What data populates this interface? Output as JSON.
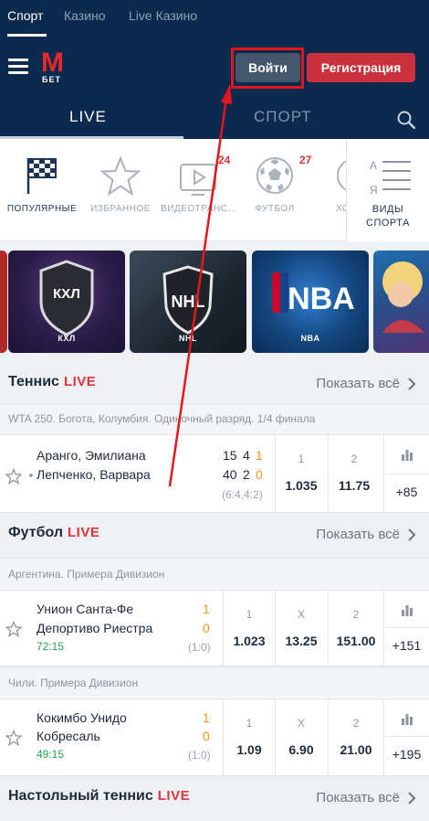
{
  "top_tabs": [
    "Спорт",
    "Казино",
    "Live Казино"
  ],
  "logo": {
    "letter": "M",
    "sub": "БЕТ"
  },
  "header": {
    "login": "Войти",
    "register": "Регистрация"
  },
  "sub_tabs": {
    "live": "LIVE",
    "sport": "СПОРТ"
  },
  "categories": [
    {
      "label": "ПОПУЛЯРНЫЕ",
      "icon": "flag-icon",
      "badge": ""
    },
    {
      "label": "ИЗБРАННОЕ",
      "icon": "star-icon",
      "badge": ""
    },
    {
      "label": "ВИДЕОТРАНС…",
      "icon": "video-icon",
      "badge": "24"
    },
    {
      "label": "ФУТБОЛ",
      "icon": "soccer-ball-icon",
      "badge": "27"
    },
    {
      "label": "ХО",
      "icon": "hockey-icon",
      "badge": ""
    }
  ],
  "sports_kinds": {
    "line1": "ВИДЫ",
    "line2": "СПОРТА",
    "az_top": "А",
    "az_bottom": "Я"
  },
  "banners": [
    "КХЛ",
    "NHL",
    "NBA"
  ],
  "banner_logos": {
    "khl": "КХЛ",
    "nhl": "NHL",
    "nba": "NBA"
  },
  "sections": [
    {
      "title": "Теннис",
      "live": "LIVE",
      "show_all": "Показать всё",
      "league": "WTA 250. Богота, Колумбия. Одиночный разряд. 1/4 финала",
      "event": {
        "team1": "Аранго, Эмилиана",
        "team2": "Лепченко, Варвара",
        "score1": [
          "15",
          "4",
          "1"
        ],
        "score2": [
          "40",
          "2",
          "0"
        ],
        "sets": "(6:4,4:2)",
        "odds": [
          {
            "l": "1",
            "v": "1.035"
          },
          {
            "l": "2",
            "v": "11.75"
          }
        ],
        "more": "+85"
      }
    },
    {
      "title": "Футбол",
      "live": "LIVE",
      "show_all": "Показать всё",
      "leagues": [
        {
          "name": "Аргентина. Примера Дивизион",
          "team1": "Унион Санта-Фе",
          "team2": "Депортиво Риестра",
          "score1": "1",
          "score2": "0",
          "time": "72:15",
          "half": "(1:0)",
          "odds": [
            {
              "l": "1",
              "v": "1.023"
            },
            {
              "l": "X",
              "v": "13.25"
            },
            {
              "l": "2",
              "v": "151.00"
            }
          ],
          "more": "+151"
        },
        {
          "name": "Чили. Примера Дивизион",
          "team1": "Кокимбо Унидо",
          "team2": "Кобресаль",
          "score1": "1",
          "score2": "0",
          "time": "49:15",
          "half": "(1:0)",
          "odds": [
            {
              "l": "1",
              "v": "1.09"
            },
            {
              "l": "X",
              "v": "6.90"
            },
            {
              "l": "2",
              "v": "21.00"
            }
          ],
          "more": "+195"
        }
      ]
    },
    {
      "title": "Настольный теннис",
      "live": "LIVE",
      "show_all": "Показать всё"
    }
  ],
  "colors": {
    "navy": "#0b2a4d",
    "red": "#c9323d",
    "live": "#e0343c",
    "score_orange": "#f0961a",
    "time_green": "#23a056"
  }
}
